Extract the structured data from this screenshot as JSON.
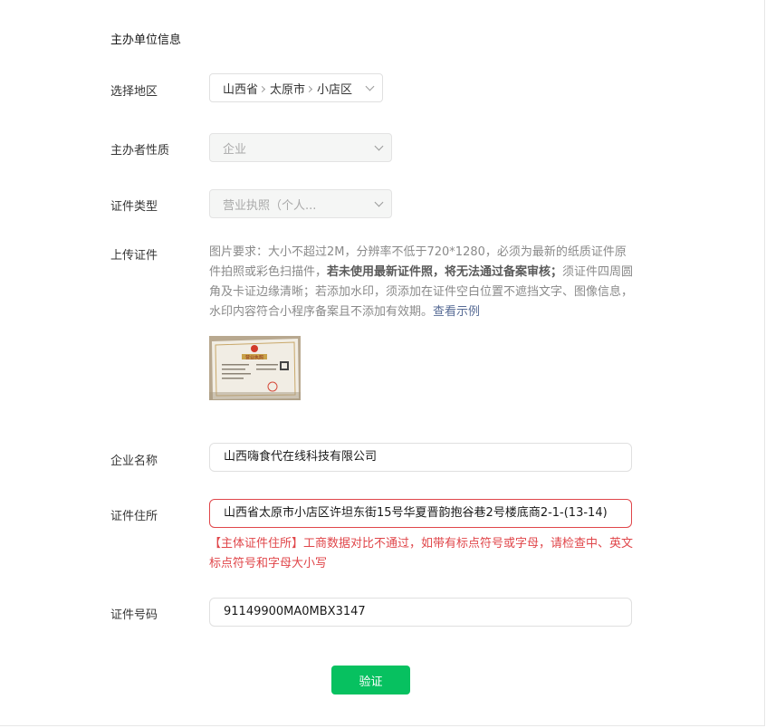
{
  "section": {
    "title": "主办单位信息"
  },
  "region": {
    "label": "选择地区",
    "province": "山西省",
    "city": "太原市",
    "district": "小店区"
  },
  "sponsor_type": {
    "label": "主办者性质",
    "value": "企业"
  },
  "cert_type": {
    "label": "证件类型",
    "value": "营业执照（个人..."
  },
  "upload": {
    "label": "上传证件",
    "desc_part1": "图片要求：大小不超过2M，分辨率不低于720*1280，必须为最新的纸质证件原件拍照或彩色扫描件，",
    "desc_bold": "若未使用最新证件照，将无法通过备案审核；",
    "desc_part2": "须证件四周圆角及卡证边缘清晰；若添加水印，须添加在证件空白位置不遮挡文字、图像信息，水印内容符合小程序备案且不添加有效期。",
    "example_link": "查看示例",
    "thumb_text": "营业执照"
  },
  "company_name": {
    "label": "企业名称",
    "value": "山西嗨食代在线科技有限公司"
  },
  "cert_address": {
    "label": "证件住所",
    "value": "山西省太原市小店区许坦东街15号华夏晋韵抱谷巷2号楼底商2-1-(13-14)",
    "error": "【主体证件住所】工商数据对比不通过，如带有标点符号或字母，请检查中、英文标点符号和字母大小写"
  },
  "cert_number": {
    "label": "证件号码",
    "value": "91149900MA0MBX3147"
  },
  "verify_button": {
    "label": "验证"
  },
  "colors": {
    "primary": "#07c160",
    "error": "#e0464a",
    "link": "#576b95"
  }
}
